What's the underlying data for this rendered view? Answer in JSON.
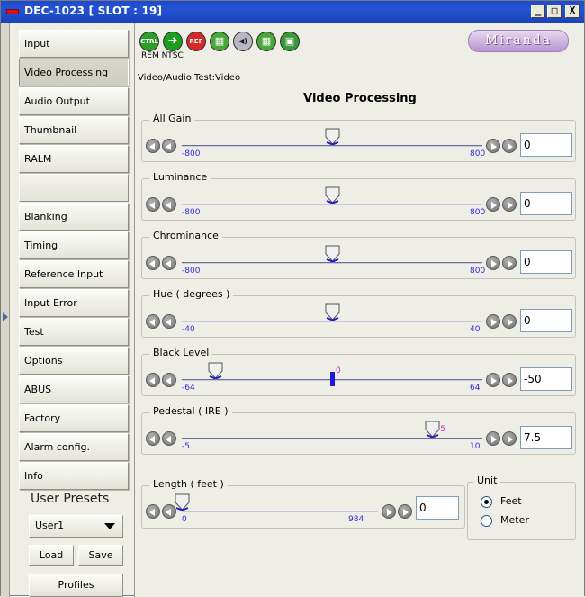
{
  "window": {
    "title": "DEC-1023 [ SLOT : 19]",
    "buttons": [
      "_",
      "□",
      "X"
    ]
  },
  "sidebar": {
    "items": [
      {
        "label": "Input"
      },
      {
        "label": "Video Processing",
        "active": true
      },
      {
        "label": "Audio Output"
      },
      {
        "label": "Thumbnail"
      },
      {
        "label": "RALM"
      },
      {
        "label": ""
      },
      {
        "label": "Blanking"
      },
      {
        "label": "Timing"
      },
      {
        "label": "Reference Input"
      },
      {
        "label": "Input Error"
      },
      {
        "label": "Test"
      },
      {
        "label": "Options"
      },
      {
        "label": "ABUS"
      },
      {
        "label": "Factory"
      },
      {
        "label": "Alarm config."
      },
      {
        "label": "Info"
      }
    ],
    "presets_label": "User Presets",
    "preset_selected": "User1",
    "load_label": "Load",
    "save_label": "Save",
    "profiles_label": "Profiles"
  },
  "toolbar": {
    "icons": [
      {
        "name": "ctrl",
        "text": "CTRL",
        "color": "#2aa02a"
      },
      {
        "name": "arrow",
        "text": "➜",
        "color": "#1e9e1e"
      },
      {
        "name": "ref",
        "text": "REF",
        "color": "#d42a2a"
      },
      {
        "name": "monitor",
        "text": "▦",
        "color": "#4aa83a"
      },
      {
        "name": "audio",
        "text": "◀)",
        "color": "#8a8a9a"
      },
      {
        "name": "monitor2",
        "text": "▦",
        "color": "#4aa83a"
      },
      {
        "name": "layers",
        "text": "▣",
        "color": "#3a9a3a"
      }
    ],
    "status_small": "REM NTSC",
    "status_line": "Video/Audio Test:Video",
    "logo_text": "Miranda"
  },
  "panel_title": "Video Processing",
  "sliders": [
    {
      "label": "All Gain",
      "min": -800,
      "max": 800,
      "value": 0,
      "input_value": "0",
      "min_label": "-800",
      "max_label": "800",
      "marker": ""
    },
    {
      "label": "Luminance",
      "min": -800,
      "max": 800,
      "value": 0,
      "input_value": "0",
      "min_label": "-800",
      "max_label": "800",
      "marker": ""
    },
    {
      "label": "Chrominance",
      "min": -800,
      "max": 800,
      "value": 0,
      "input_value": "0",
      "min_label": "-800",
      "max_label": "800",
      "marker": ""
    },
    {
      "label": "Hue ( degrees )",
      "min": -40,
      "max": 40,
      "value": 0,
      "input_value": "0",
      "min_label": "-40",
      "max_label": "40",
      "marker": ""
    },
    {
      "label": "Black Level",
      "min": -64,
      "max": 64,
      "value": -50,
      "input_value": "-50",
      "min_label": "-64",
      "max_label": "64",
      "marker": "0",
      "marker_value": 0
    },
    {
      "label": "Pedestal ( IRE )",
      "min": -5,
      "max": 10,
      "value": 7.5,
      "input_value": "7.5",
      "min_label": "-5",
      "max_label": "10",
      "marker": "5",
      "marker_value": 7.5
    }
  ],
  "length": {
    "label": "Length ( feet )",
    "min": 0,
    "max": 984,
    "value": 0,
    "input_value": "0",
    "min_label": "0",
    "max_label": "984"
  },
  "unit": {
    "title": "Unit",
    "options": [
      {
        "label": "Feet",
        "checked": true
      },
      {
        "label": "Meter",
        "checked": false
      }
    ]
  }
}
